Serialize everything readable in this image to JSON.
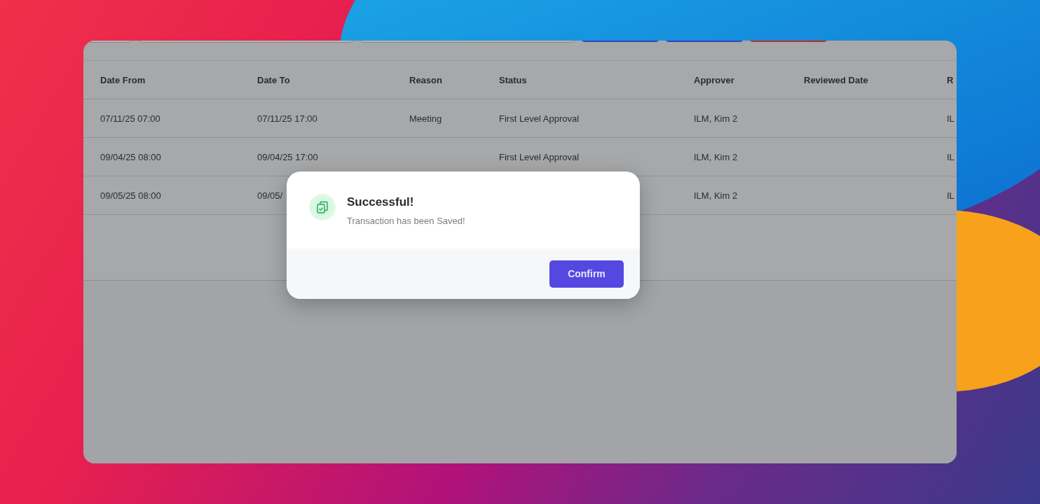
{
  "toolbar": [
    {
      "kind": "field"
    },
    {
      "kind": "field"
    },
    {
      "kind": "field"
    },
    {
      "kind": "button",
      "color": "#3b3fc0"
    },
    {
      "kind": "button",
      "color": "#3b3fc0"
    },
    {
      "kind": "button",
      "color": "#c42a2a"
    }
  ],
  "table": {
    "columns": [
      "Date From",
      "Date To",
      "Reason",
      "Status",
      "Approver",
      "Reviewed Date",
      "R"
    ],
    "rows": [
      [
        "07/11/25 07:00",
        "07/11/25 17:00",
        "Meeting",
        "First Level Approval",
        "ILM, Kim 2",
        "",
        "IL"
      ],
      [
        "09/04/25 08:00",
        "09/04/25 17:00",
        "",
        "First Level Approval",
        "ILM, Kim 2",
        "",
        "IL"
      ],
      [
        "09/05/25 08:00",
        "09/05/",
        "",
        "",
        "ILM, Kim 2",
        "",
        "IL"
      ]
    ]
  },
  "dialog": {
    "title": "Successful!",
    "message": "Transaction has been Saved!",
    "button": "Confirm"
  }
}
